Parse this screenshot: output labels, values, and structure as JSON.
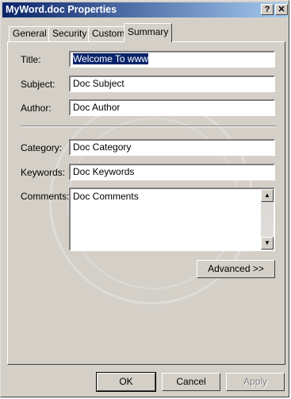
{
  "window": {
    "title": "MyWord.doc Properties",
    "help_label": "?",
    "close_label": "✕"
  },
  "tabs": [
    {
      "label": "General"
    },
    {
      "label": "Security"
    },
    {
      "label": "Custom"
    },
    {
      "label": "Summary",
      "selected": true
    }
  ],
  "fields": {
    "title": {
      "label": "Title:",
      "value": "Welcome To www"
    },
    "subject": {
      "label": "Subject:",
      "value": "Doc Subject"
    },
    "author": {
      "label": "Author:",
      "value": "Doc Author"
    },
    "category": {
      "label": "Category:",
      "value": "Doc Category"
    },
    "keywords": {
      "label": "Keywords:",
      "value": "Doc Keywords"
    },
    "comments": {
      "label": "Comments:",
      "value": "Doc Comments"
    }
  },
  "scrollbar": {
    "up_icon": "▲",
    "down_icon": "▼"
  },
  "buttons": {
    "advanced": "Advanced >>",
    "ok": "OK",
    "cancel": "Cancel",
    "apply": "Apply"
  },
  "colors": {
    "title_bar_start": "#0a246a",
    "title_bar_end": "#a6caf0",
    "face": "#d4d0c8",
    "selection": "#0a246a"
  }
}
